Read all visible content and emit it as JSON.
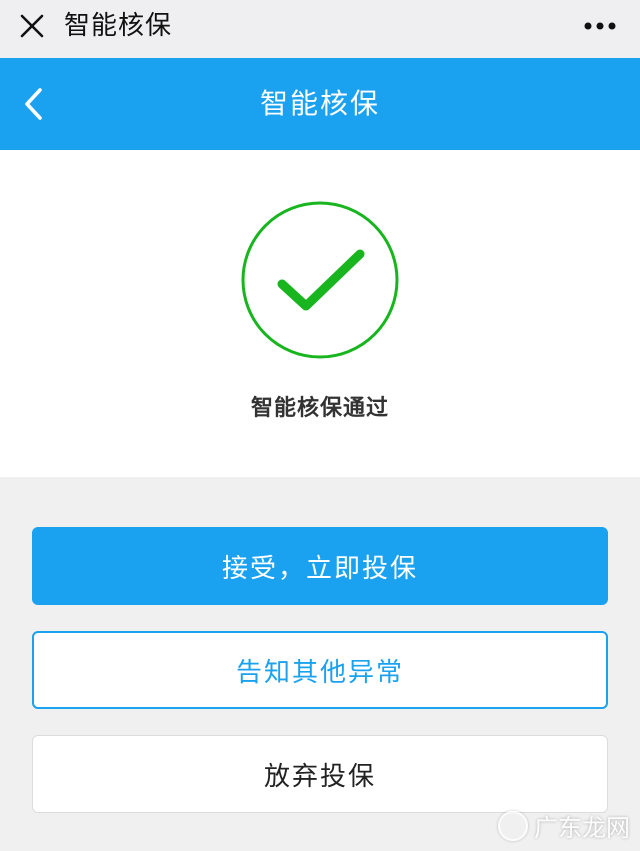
{
  "topbar": {
    "title": "智能核保",
    "close_icon": "close-icon",
    "more_icon": "more-icon"
  },
  "header": {
    "title": "智能核保",
    "back_icon": "chevron-left-icon",
    "background": "#1aa1ef"
  },
  "result": {
    "icon": "check-circle-icon",
    "icon_color": "#18b51f",
    "message": "智能核保通过"
  },
  "actions": {
    "accept_label": "接受，立即投保",
    "report_label": "告知其他异常",
    "abandon_label": "放弃投保"
  },
  "watermark": {
    "text": "广东龙网"
  },
  "colors": {
    "accent": "#1aa1ef",
    "success": "#18b51f"
  }
}
